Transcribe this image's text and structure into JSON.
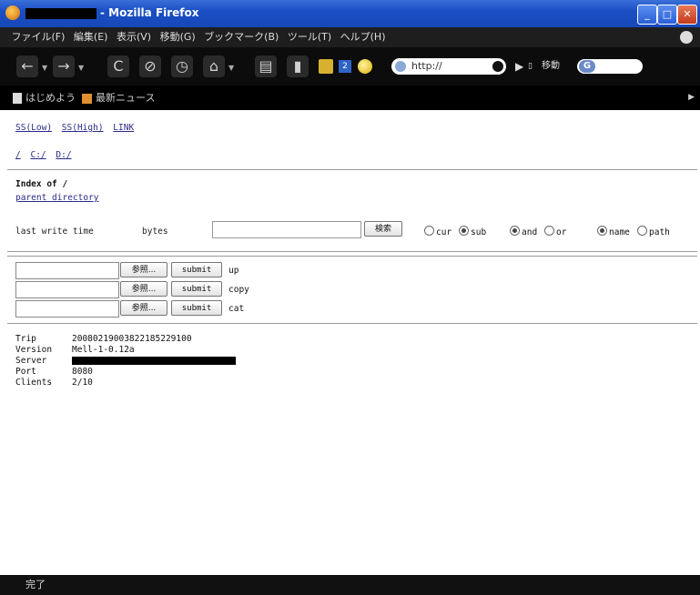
{
  "window": {
    "title": "- Mozilla Firefox",
    "min_label": "_",
    "max_label": "□",
    "close_label": "✕"
  },
  "menu": [
    "ファイル(F)",
    "編集(E)",
    "表示(V)",
    "移動(G)",
    "ブックマーク(B)",
    "ツール(T)",
    "ヘルプ(H)"
  ],
  "toolbar": {
    "back_glyph": "←",
    "forward_glyph": "→",
    "reload_glyph": "C",
    "stop_glyph": "⊘",
    "history_glyph": "◷",
    "home_glyph": "⌂",
    "print_glyph": "▤",
    "trash_glyph": "▮",
    "badge_count": "2",
    "url": "http://",
    "go_label": "移動",
    "search_engine": "G"
  },
  "bookmarks": {
    "first": "はじめよう",
    "second": "最新ニュース"
  },
  "page": {
    "links_top": [
      "SS(Low)",
      "SS(High)",
      "LINK"
    ],
    "drives": [
      "/",
      "C:/",
      "D:/"
    ],
    "index_title": "Index of /",
    "parent_link": "parent directory",
    "search": {
      "col_time": "last write time",
      "col_bytes": "bytes",
      "query": "",
      "button": "検索",
      "radio_scope": [
        {
          "label": "cur",
          "checked": false
        },
        {
          "label": "sub",
          "checked": true
        }
      ],
      "radio_logic": [
        {
          "label": "and",
          "checked": true
        },
        {
          "label": "or",
          "checked": false
        }
      ],
      "radio_target": [
        {
          "label": "name",
          "checked": true
        },
        {
          "label": "path",
          "checked": false
        }
      ]
    },
    "file_ops": [
      {
        "browse": "参照...",
        "submit": "submit",
        "op": "up"
      },
      {
        "browse": "参照...",
        "submit": "submit",
        "op": "copy"
      },
      {
        "browse": "参照...",
        "submit": "submit",
        "op": "cat"
      }
    ],
    "info": {
      "trip_label": "Trip",
      "trip_value": "20080219003822185229100",
      "version_label": "Version",
      "version_value": "Mell-1-0.12a",
      "server_label": "Server",
      "port_label": "Port",
      "port_value": "8080",
      "clients_label": "Clients",
      "clients_value": "2/10"
    }
  },
  "status": {
    "text": "完了"
  }
}
